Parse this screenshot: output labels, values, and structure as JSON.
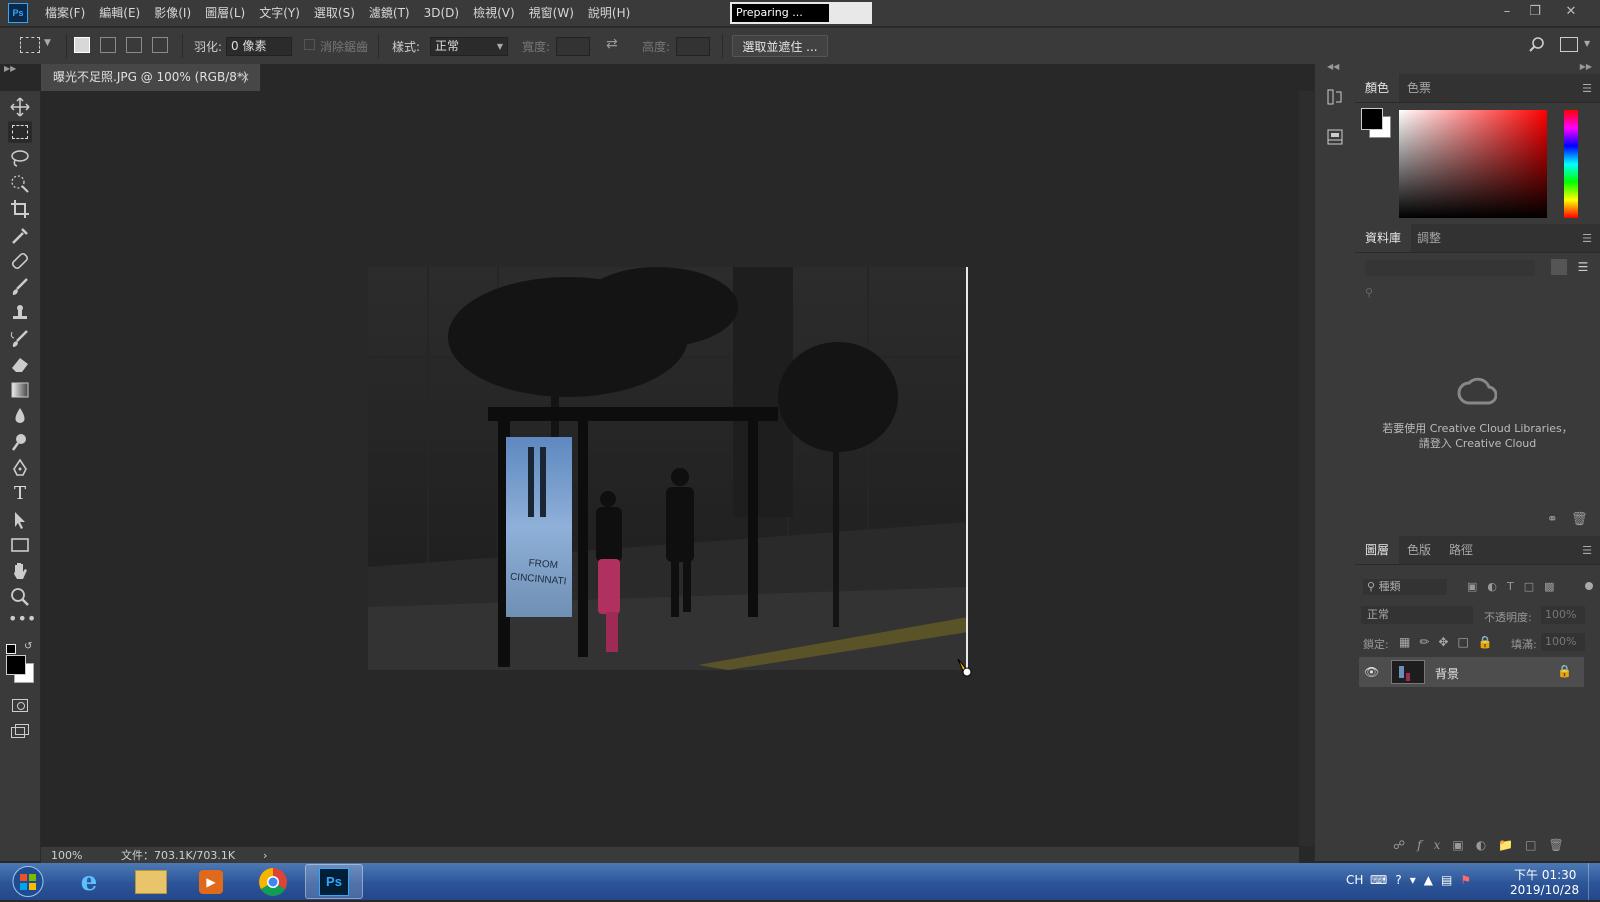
{
  "menu": {
    "app_icon": "Ps",
    "items": [
      "檔案(F)",
      "編輯(E)",
      "影像(I)",
      "圖層(L)",
      "文字(Y)",
      "選取(S)",
      "濾鏡(T)",
      "3D(D)",
      "檢視(V)",
      "視窗(W)",
      "說明(H)"
    ]
  },
  "progress": {
    "label": "Preparing ...",
    "fraction": 0.7
  },
  "options": {
    "feather_label": "羽化:",
    "feather_value": "0 像素",
    "antialias_label": "消除鋸齒",
    "style_label": "樣式:",
    "style_value": "正常",
    "width_label": "寬度:",
    "height_label": "高度:",
    "select_mask_button": "選取並遮住 ..."
  },
  "document": {
    "tab_title": "曝光不足照.JPG @ 100% (RGB/8*)",
    "close_glyph": "×"
  },
  "photo": {
    "poster_text": [
      "FROM",
      "CINCINNATI"
    ]
  },
  "status": {
    "zoom": "100%",
    "doc_size": "文件：703.1K/703.1K",
    "arrow": "›"
  },
  "panels": {
    "color_tabs": [
      "顏色",
      "色票"
    ],
    "library_tabs": [
      "資料庫",
      "調整"
    ],
    "library_message_line1": "若要使用 Creative Cloud Libraries，",
    "library_message_line2": "請登入 Creative Cloud",
    "layers_tabs": [
      "圖層",
      "色版",
      "路徑"
    ],
    "layers_search_placeholder": "種類",
    "blend_mode": "正常",
    "opacity_label": "不透明度:",
    "opacity_value": "100%",
    "lock_label": "鎖定:",
    "fill_label": "填滿:",
    "fill_value": "100%",
    "layer_name": "背景"
  },
  "taskbar": {
    "language": "CH",
    "time": "下午 01:30",
    "date": "2019/10/28"
  },
  "colors": {
    "accent": "#31a8ff",
    "chrome": "#3a3a3a",
    "canvas_bg": "#282828",
    "taskbar": "#2c5598"
  }
}
